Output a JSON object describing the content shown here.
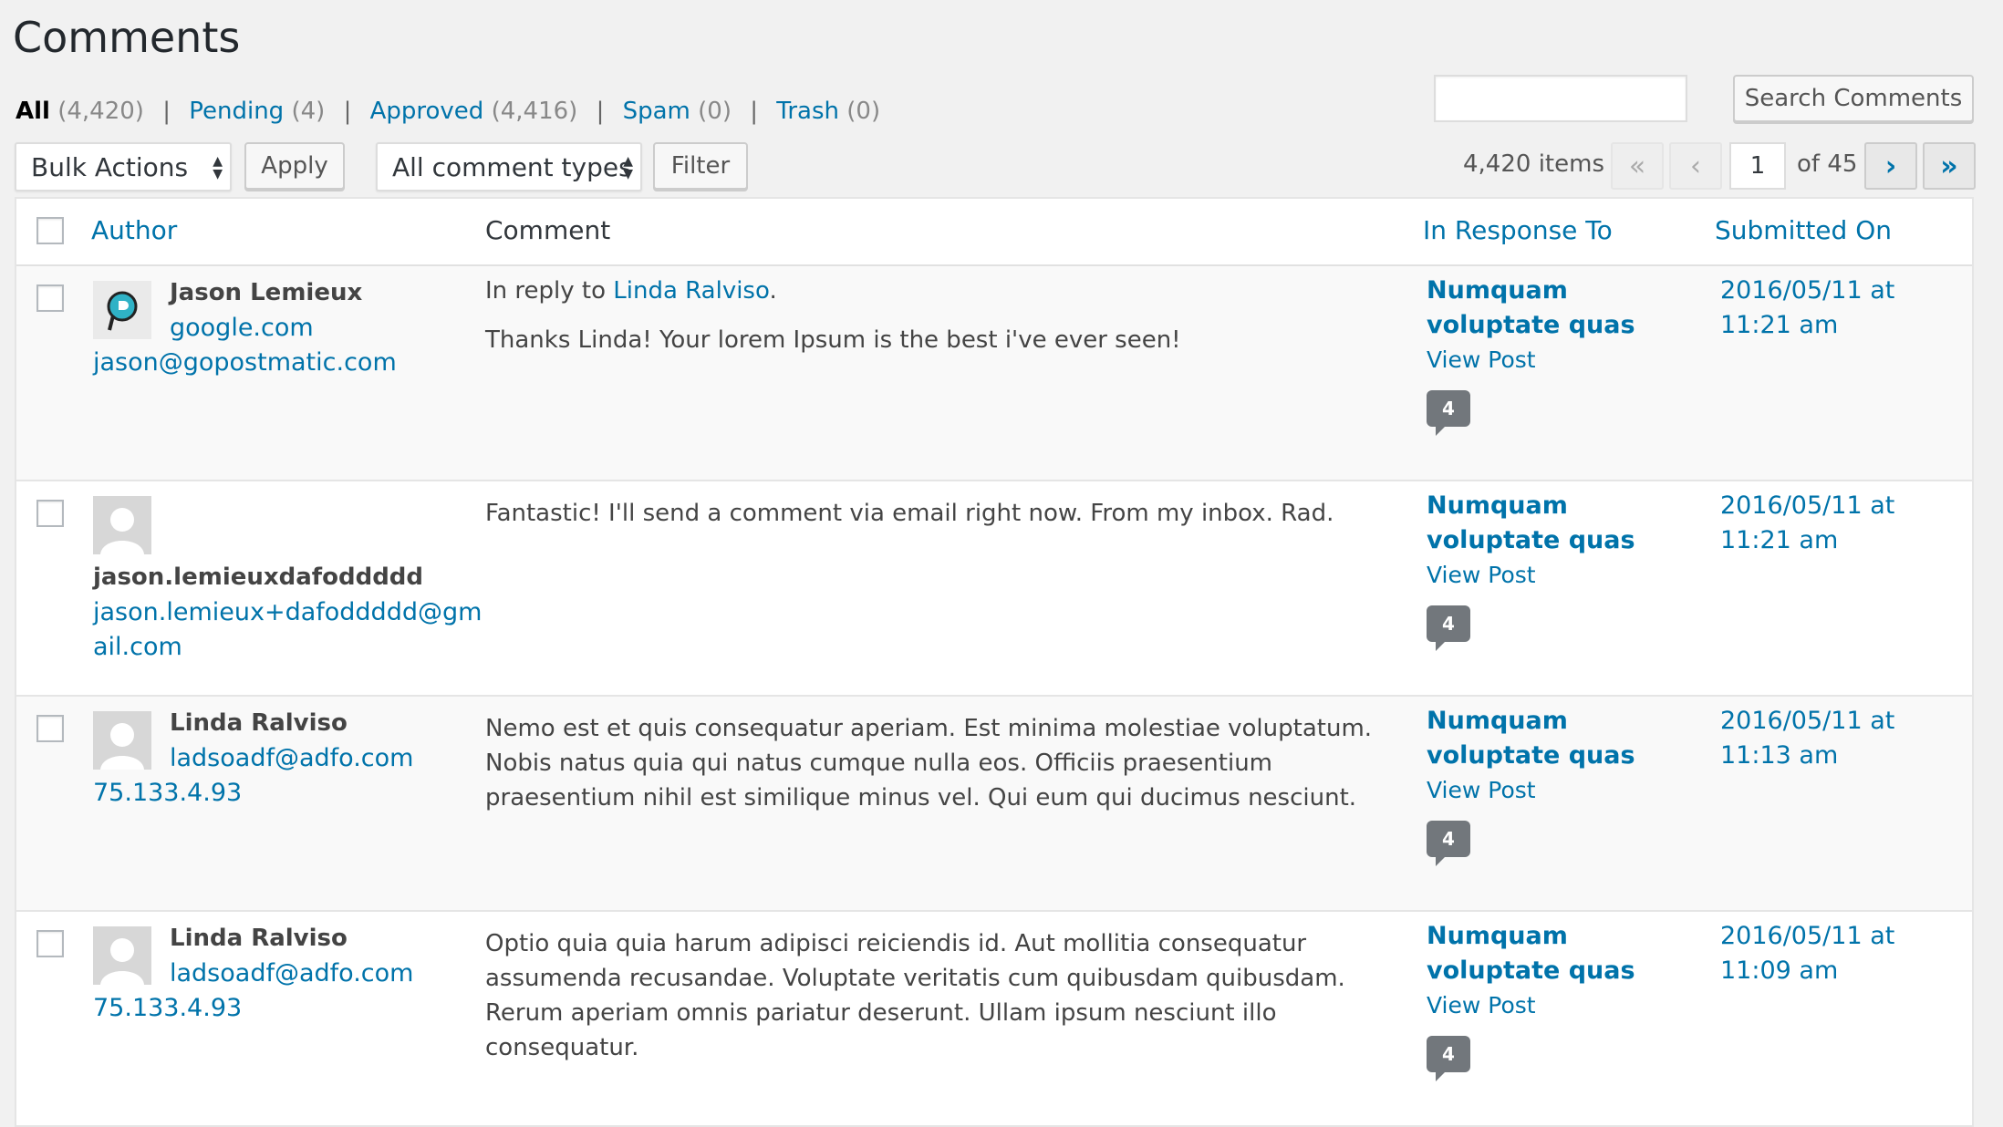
{
  "page_title": "Comments",
  "views": [
    {
      "label": "All",
      "count": "(4,420)"
    },
    {
      "label": "Pending",
      "count": "(4)"
    },
    {
      "label": "Approved",
      "count": "(4,416)"
    },
    {
      "label": "Spam",
      "count": "(0)"
    },
    {
      "label": "Trash",
      "count": "(0)"
    }
  ],
  "separator": "|",
  "search": {
    "button": "Search Comments",
    "value": ""
  },
  "bulk": {
    "select": "Bulk Actions",
    "apply": "Apply"
  },
  "filter": {
    "select": "All comment types",
    "button": "Filter"
  },
  "pagination": {
    "items": "4,420 items",
    "first": "«",
    "prev": "‹",
    "current": "1",
    "of": "of 45",
    "next": "›",
    "last": "»"
  },
  "columns": {
    "author": "Author",
    "comment": "Comment",
    "response": "In Response To",
    "submitted": "Submitted On"
  },
  "rows": [
    {
      "author_name": "Jason Lemieux",
      "author_url": "google.com",
      "author_contact": "jason@gopostmatic.com",
      "reply_prefix": "In reply to ",
      "reply_to": "Linda Ralviso",
      "reply_suffix": ".",
      "comment": "Thanks Linda! Your lorem Ipsum is the best i've ever seen!",
      "post_title": "Numquam voluptate quas",
      "view_post": "View Post",
      "comment_count": "4",
      "date": "2016/05/11 at 11:21 am"
    },
    {
      "author_name": "jason.lemieuxdafoddddd",
      "author_contact_1": "jason.lemieux+dafoddddd@gm",
      "author_contact_2": "ail.com",
      "comment": "Fantastic! I'll send a comment via email right now. From my inbox. Rad.",
      "post_title": "Numquam voluptate quas",
      "view_post": "View Post",
      "comment_count": "4",
      "date": "2016/05/11 at 11:21 am"
    },
    {
      "author_name": "Linda Ralviso",
      "author_url": "ladsoadf@adfo.com",
      "author_ip": "75.133.4.93",
      "comment": "Nemo est et quis consequatur aperiam. Est minima molestiae voluptatum. Nobis natus quia qui natus cumque nulla eos. Officiis praesentium praesentium nihil est similique minus vel. Qui eum qui ducimus nesciunt.",
      "post_title": "Numquam voluptate quas",
      "view_post": "View Post",
      "comment_count": "4",
      "date": "2016/05/11 at 11:13 am"
    },
    {
      "author_name": "Linda Ralviso",
      "author_url": "ladsoadf@adfo.com",
      "author_ip": "75.133.4.93",
      "comment": "Optio quia quia harum adipisci reiciendis id. Aut mollitia consequatur assumenda recusandae. Voluptate veritatis cum quibusdam quibusdam. Rerum aperiam omnis pariatur deserunt. Ullam ipsum nesciunt illo consequatur.",
      "post_title": "Numquam voluptate quas",
      "view_post": "View Post",
      "comment_count": "4",
      "date": "2016/05/11 at 11:09 am"
    }
  ]
}
